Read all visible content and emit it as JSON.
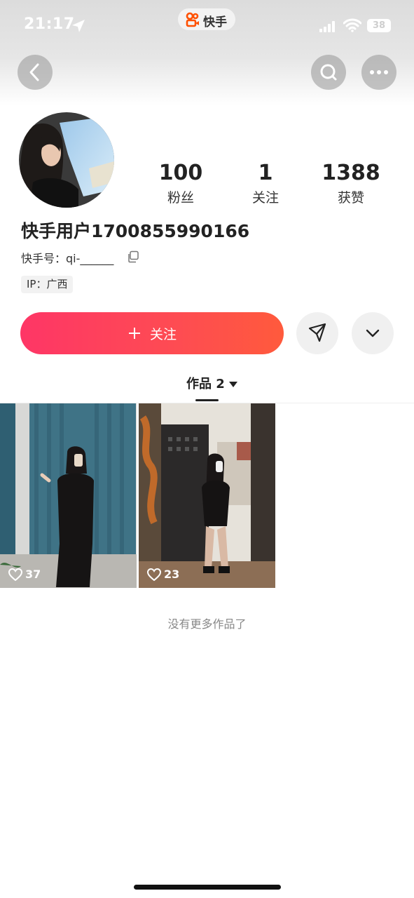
{
  "status_bar": {
    "time": "21:17",
    "battery": "38",
    "app_pill_label": "快手"
  },
  "nav": {
    "back_icon": "chevron-left-icon",
    "search_icon": "search-icon",
    "more_icon": "more-horizontal-icon"
  },
  "profile": {
    "stats": [
      {
        "value": "100",
        "label": "粉丝"
      },
      {
        "value": "1",
        "label": "关注"
      },
      {
        "value": "1388",
        "label": "获赞"
      }
    ],
    "username": "快手用户1700855990166",
    "kuaishou_id": "快手号：qi-______",
    "ip_location": "IP：广西"
  },
  "actions": {
    "follow_label": "关注",
    "share_icon": "send-icon",
    "expand_icon": "chevron-down-icon"
  },
  "tabs": {
    "works_label": "作品 2"
  },
  "works": [
    {
      "likes": "37"
    },
    {
      "likes": "23"
    }
  ],
  "footer": {
    "no_more": "没有更多作品了"
  },
  "colors": {
    "accent": "#fe3666",
    "accent_end": "#ff5a3c",
    "muted_text": "#888888"
  }
}
